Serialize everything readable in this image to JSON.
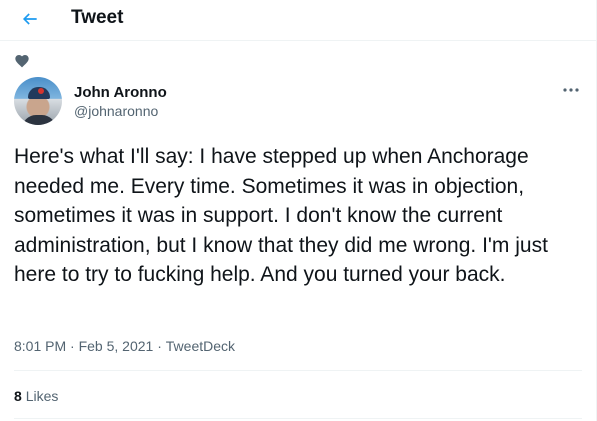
{
  "header": {
    "title": "Tweet",
    "back_icon": "arrow-left-icon"
  },
  "tweet": {
    "liked_icon": "heart-icon",
    "author": {
      "name": "John Aronno",
      "handle": "@johnaronno"
    },
    "text": "Here's what I'll say: I have stepped up when Anchorage needed me. Every time. Sometimes it was in objection, sometimes it was in support. I don't know the current administration, but I know that they did me wrong. I'm just here to try to fucking help. And you turned your back.",
    "time": "8:01 PM",
    "date": "Feb 5, 2021",
    "separator": " · ",
    "source": "TweetDeck",
    "likes": {
      "count": "8",
      "label": "Likes"
    }
  },
  "colors": {
    "accent": "#1d9bf0",
    "text": "#0f1419",
    "secondary": "#536471",
    "border": "#eff3f4"
  }
}
